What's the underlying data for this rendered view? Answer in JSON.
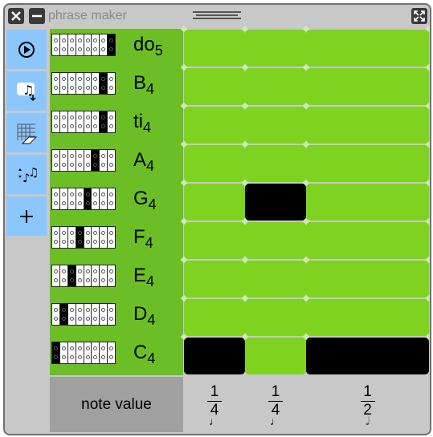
{
  "window": {
    "title": "phrase maker"
  },
  "toolbar": {
    "items": [
      "play",
      "save",
      "clear",
      "sort",
      "add"
    ]
  },
  "rows": [
    {
      "pitch": "do",
      "octave": "5",
      "active_key": 7
    },
    {
      "pitch": "B",
      "octave": "4",
      "active_key": 6
    },
    {
      "pitch": "ti",
      "octave": "4",
      "active_key": 6
    },
    {
      "pitch": "A",
      "octave": "4",
      "active_key": 5
    },
    {
      "pitch": "G",
      "octave": "4",
      "active_key": 4
    },
    {
      "pitch": "F",
      "octave": "4",
      "active_key": 3
    },
    {
      "pitch": "E",
      "octave": "4",
      "active_key": 2
    },
    {
      "pitch": "D",
      "octave": "4",
      "active_key": 1
    },
    {
      "pitch": "C",
      "octave": "4",
      "active_key": 0
    }
  ],
  "columns": [
    {
      "numerator": "1",
      "denominator": "4",
      "glyph": "♩"
    },
    {
      "numerator": "1",
      "denominator": "4",
      "glyph": "♩"
    },
    {
      "numerator": "1",
      "denominator": "2",
      "glyph": "𝅗𝅥"
    }
  ],
  "active_cells": [
    [
      4,
      1
    ],
    [
      8,
      0
    ],
    [
      8,
      2
    ]
  ],
  "footer": {
    "note_value_label": "note value"
  },
  "colors": {
    "cell": "#7ed321",
    "cell_on": "#000000",
    "label_bg": "#6cbe26",
    "toolbar_bg": "#8cc6ff"
  }
}
